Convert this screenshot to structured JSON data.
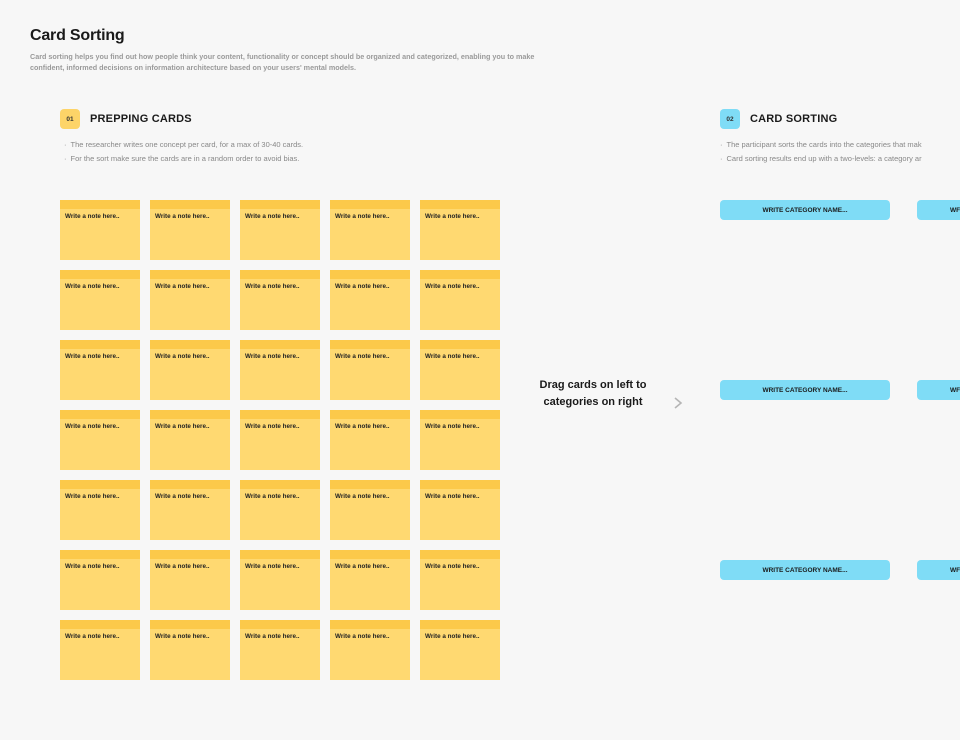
{
  "page": {
    "title": "Card Sorting",
    "description": "Card sorting helps you find out how people think your content, functionality or concept should be organized and categorized, enabling you to make confident, informed decisions on information architecture based on your users' mental models."
  },
  "section1": {
    "number": "01",
    "title": "PREPPING CARDS",
    "bullets": [
      "The researcher writes one concept per card, for a max of 30-40 cards.",
      "For the sort make sure the cards are in a random order to avoid bias."
    ],
    "card_text": "Write a note here..",
    "card_count": 35
  },
  "section2": {
    "number": "02",
    "title": "CARD SORTING",
    "bullets": [
      "The participant sorts the cards into the categories that mak",
      "Card sorting results end up with a two-levels: a category ar"
    ],
    "category_label": "WRITE CATEGORY NAME...",
    "category_label_clipped": "WF"
  },
  "drag_hint": "Drag cards on left to categories on right",
  "colors": {
    "card": "#ffd971",
    "card_top": "#fcc94a",
    "category": "#7fdcf6",
    "background": "#f7f7f7"
  }
}
